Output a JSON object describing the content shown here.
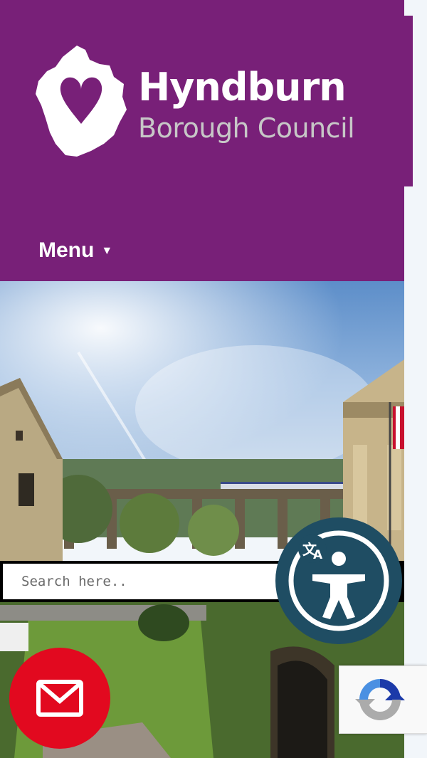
{
  "header": {
    "logo_title": "Hyndburn",
    "logo_subtitle": "Borough Council",
    "menu_label": "Menu",
    "background_color": "#782078"
  },
  "search": {
    "placeholder": "Search here..",
    "value": ""
  },
  "widgets": {
    "accessibility_icon": "accessibility-translate-icon",
    "mail_icon": "envelope-icon",
    "recaptcha_icon": "recaptcha-logo-icon",
    "accessibility_color": "#1f4d63",
    "mail_color": "#e2091f"
  }
}
